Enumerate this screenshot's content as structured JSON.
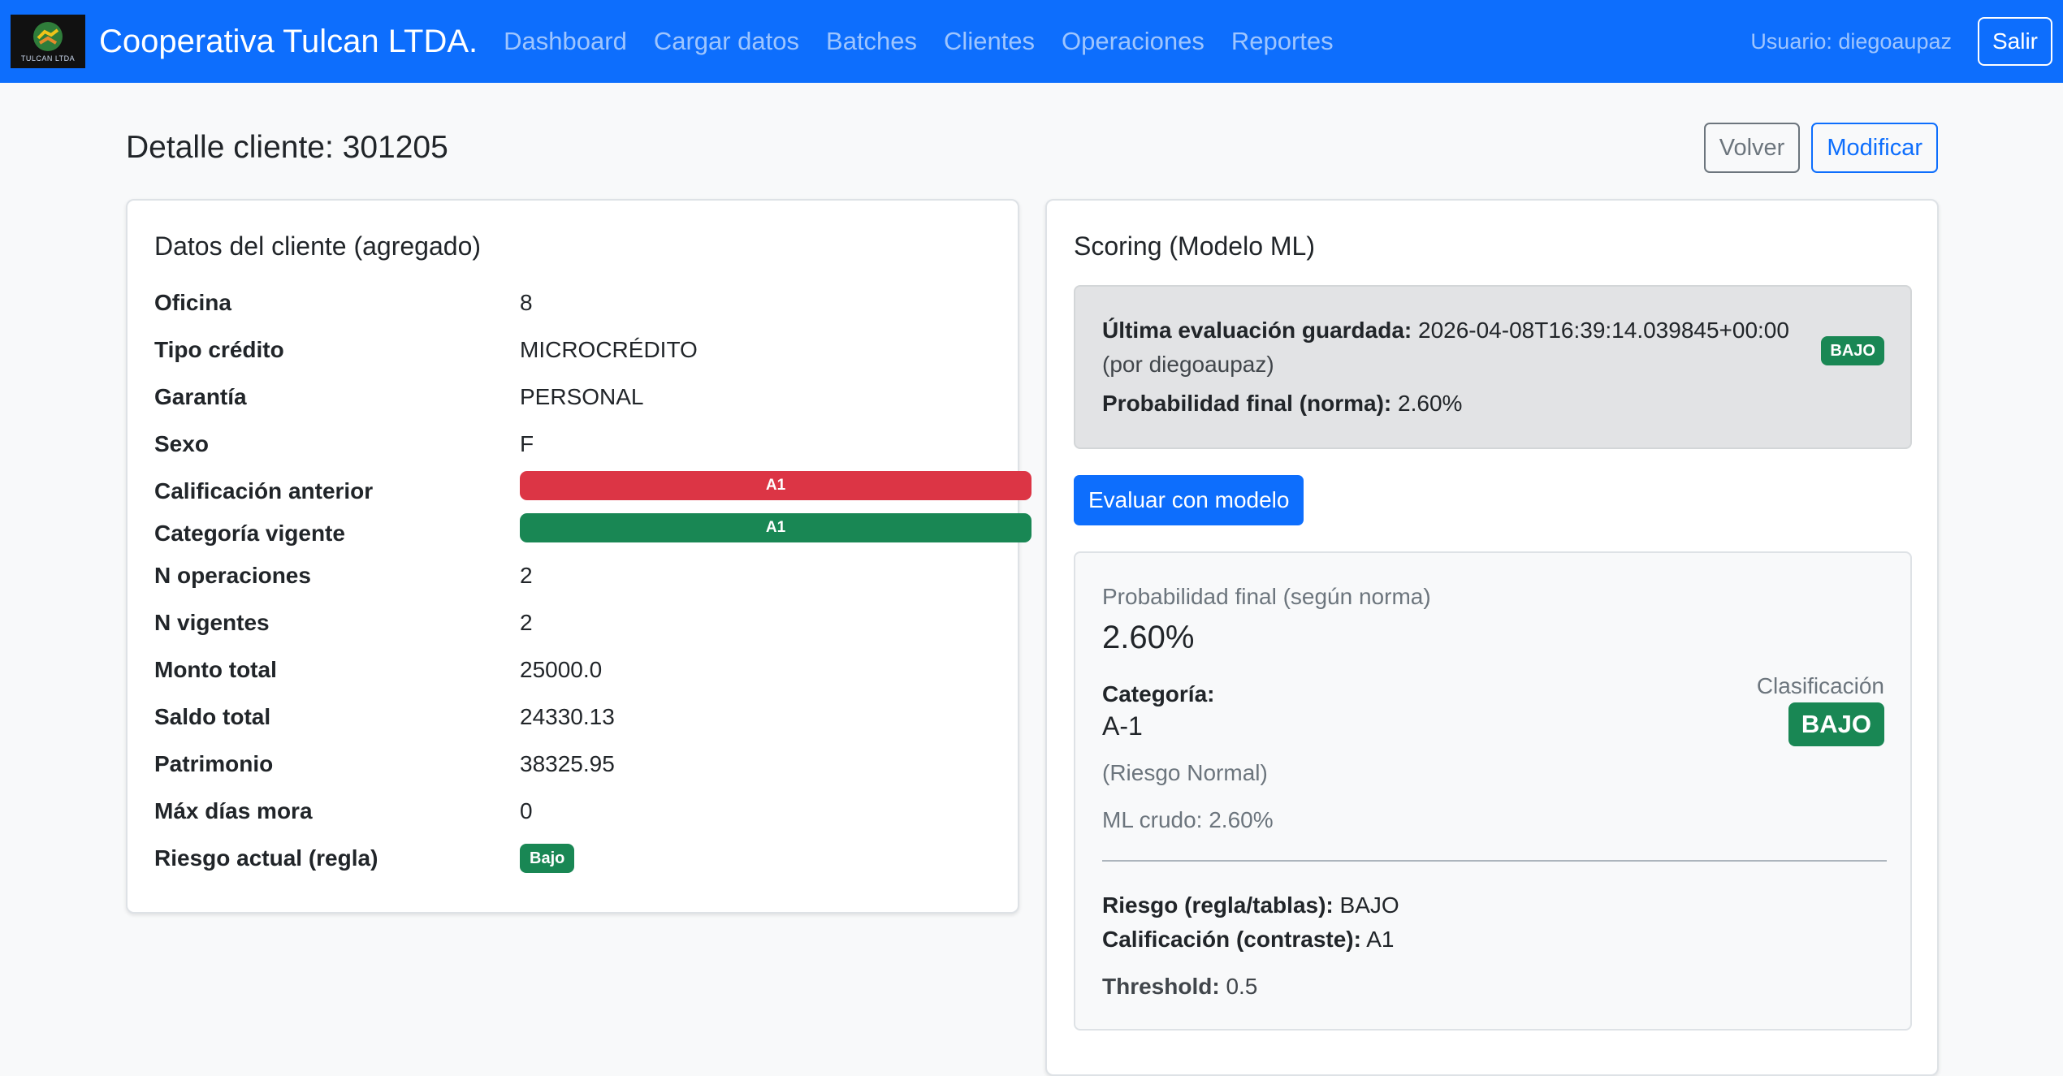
{
  "navbar": {
    "logo_text": "TULCAN LTDA",
    "brand": "Cooperativa Tulcan LTDA.",
    "links": [
      "Dashboard",
      "Cargar datos",
      "Batches",
      "Clientes",
      "Operaciones",
      "Reportes"
    ],
    "user": "Usuario: diegoaupaz",
    "logout": "Salir"
  },
  "header": {
    "title": "Detalle cliente: 301205",
    "back": "Volver",
    "edit": "Modificar"
  },
  "client_card": {
    "title": "Datos del cliente (agregado)",
    "rows": [
      {
        "label": "Oficina",
        "value": "8"
      },
      {
        "label": "Tipo crédito",
        "value": "MICROCRÉDITO"
      },
      {
        "label": "Garantía",
        "value": "PERSONAL"
      },
      {
        "label": "Sexo",
        "value": "F"
      },
      {
        "label": "Calificación anterior",
        "value": "A1"
      },
      {
        "label": "Categoría vigente",
        "value": "A1"
      },
      {
        "label": "N operaciones",
        "value": "2"
      },
      {
        "label": "N vigentes",
        "value": "2"
      },
      {
        "label": "Monto total",
        "value": "25000.0"
      },
      {
        "label": "Saldo total",
        "value": "24330.13"
      },
      {
        "label": "Patrimonio",
        "value": "38325.95"
      },
      {
        "label": "Máx días mora",
        "value": "0"
      },
      {
        "label": "Riesgo actual (regla)",
        "value": "Bajo"
      }
    ],
    "colors": {
      "danger": "#dc3545",
      "success": "#198754"
    }
  },
  "scoring_card": {
    "title": "Scoring (Modelo ML)",
    "last_eval": {
      "label": "Última evaluación guardada:",
      "timestamp": "2026-04-08T16:39:14.039845+00:00",
      "by": "(por diegoaupaz)",
      "prob_label": "Probabilidad final (norma):",
      "prob_value": "2.60%",
      "badge": "BAJO"
    },
    "evaluate_button": "Evaluar con modelo",
    "result": {
      "prob_heading": "Probabilidad final (según norma)",
      "prob_value": "2.60%",
      "category_label": "Categoría:",
      "category_value": "A-1",
      "category_note": "(Riesgo Normal)",
      "ml_raw": "ML crudo: 2.60%",
      "classification_label": "Clasificación",
      "classification_value": "BAJO",
      "risk_label": "Riesgo (regla/tablas):",
      "risk_value": "BAJO",
      "contrast_label": "Calificación (contraste):",
      "contrast_value": "A1",
      "threshold_label": "Threshold:",
      "threshold_value": "0.5"
    }
  }
}
